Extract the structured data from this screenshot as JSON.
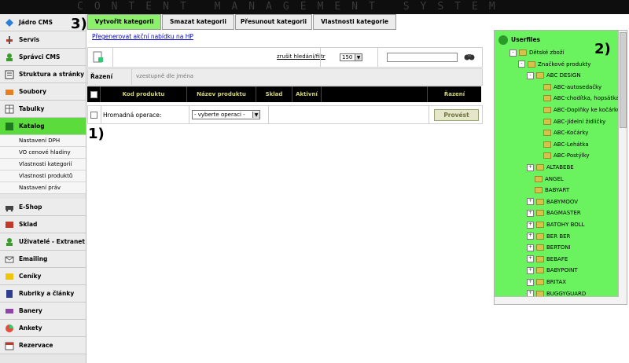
{
  "header": {
    "title": "CONTENT MANAGEMENT SYSTEM"
  },
  "sidebar": {
    "items": [
      {
        "label": "Jádro CMS",
        "icon": "diamond-icon"
      },
      {
        "label": "Servis",
        "icon": "tools-icon"
      },
      {
        "label": "Správci CMS",
        "icon": "users-icon"
      },
      {
        "label": "Struktura a stránky",
        "icon": "pages-icon"
      },
      {
        "label": "Soubory",
        "icon": "files-icon"
      },
      {
        "label": "Tabulky",
        "icon": "table-icon"
      },
      {
        "label": "Katalog",
        "icon": "catalog-icon",
        "active": true
      }
    ],
    "subitems": [
      "Nastavení DPH",
      "VO cenové hladiny",
      "Vlastnosti kategorií",
      "Vlastnosti produktů",
      "Nastavení práv"
    ],
    "items2": [
      {
        "label": "E-Shop"
      },
      {
        "label": "Sklad"
      },
      {
        "label": "Uživatelé - Extranet"
      },
      {
        "label": "Emailing"
      },
      {
        "label": "Ceníky"
      },
      {
        "label": "Rubriky a články"
      },
      {
        "label": "Banery"
      },
      {
        "label": "Ankety"
      },
      {
        "label": "Rezervace"
      }
    ]
  },
  "tabs": [
    {
      "label": "Vytvořit kategorii",
      "active": true
    },
    {
      "label": "Smazat kategorii"
    },
    {
      "label": "Přesunout kategorii"
    },
    {
      "label": "Vlastnosti kategorie"
    }
  ],
  "action_link": "Přegenerovat akční nabídku na HP",
  "toolbar": {
    "cancel_search": "zrušit hledání/filtr",
    "per_page": "150",
    "search_value": ""
  },
  "sort": {
    "label": "Řazení",
    "value": "vzestupně dle jména"
  },
  "table": {
    "columns": [
      "Kod produktu",
      "Název produktu",
      "Sklad",
      "Aktivní",
      "Řazení"
    ],
    "bulk_label": "Hromadná operace:",
    "bulk_select": "- vyberte operaci -",
    "proceed": "Provést"
  },
  "tree": {
    "root": "Userfiles",
    "nodes": [
      {
        "label": "Dětské zboží",
        "level": 1,
        "pm": "-"
      },
      {
        "label": "Značkové produkty",
        "level": 2,
        "pm": "-"
      },
      {
        "label": "ABC DESIGN",
        "level": 3,
        "pm": "-"
      },
      {
        "label": "ABC-autosedačky",
        "level": 4,
        "pm": ""
      },
      {
        "label": "ABC-chodítka, hopsátka",
        "level": 4,
        "pm": ""
      },
      {
        "label": "ABC-Doplňky ke kočárkům",
        "level": 4,
        "pm": ""
      },
      {
        "label": "ABC-Jídelní židličky",
        "level": 4,
        "pm": ""
      },
      {
        "label": "ABC-Kočárky",
        "level": 4,
        "pm": ""
      },
      {
        "label": "ABC-Lehátka",
        "level": 4,
        "pm": ""
      },
      {
        "label": "ABC-Postýlky",
        "level": 4,
        "pm": ""
      },
      {
        "label": "ALTABEBE",
        "level": 3,
        "pm": "+"
      },
      {
        "label": "ANGEL",
        "level": 3,
        "pm": ""
      },
      {
        "label": "BABYART",
        "level": 3,
        "pm": ""
      },
      {
        "label": "BABYMOOV",
        "level": 3,
        "pm": "+"
      },
      {
        "label": "BAGMASTER",
        "level": 3,
        "pm": "+"
      },
      {
        "label": "BATOHY BOLL",
        "level": 3,
        "pm": "+"
      },
      {
        "label": "BER BER",
        "level": 3,
        "pm": "+"
      },
      {
        "label": "BERTONI",
        "level": 3,
        "pm": "+"
      },
      {
        "label": "BEBAFE",
        "level": 3,
        "pm": "+"
      },
      {
        "label": "BABYPOINT",
        "level": 3,
        "pm": "+"
      },
      {
        "label": "BRITAX",
        "level": 3,
        "pm": "+"
      },
      {
        "label": "BUGGYGUARD",
        "level": 3,
        "pm": "+"
      }
    ]
  },
  "annotations": {
    "a1": "1)",
    "a2": "2)",
    "a3": "3)"
  }
}
